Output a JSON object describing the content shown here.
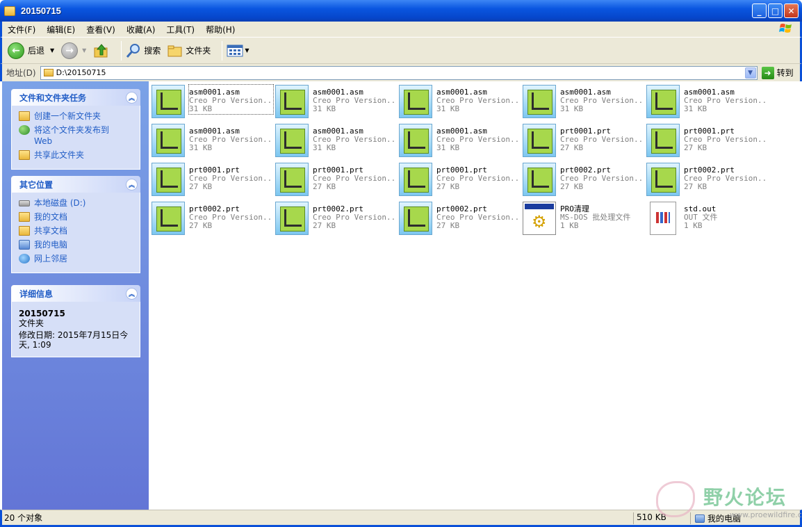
{
  "window": {
    "title": "20150715"
  },
  "menu": [
    "文件(F)",
    "编辑(E)",
    "查看(V)",
    "收藏(A)",
    "工具(T)",
    "帮助(H)"
  ],
  "toolbar": {
    "back": "后退",
    "search": "搜索",
    "folders": "文件夹"
  },
  "address": {
    "label": "地址(D)",
    "value": "D:\\20150715",
    "go": "转到"
  },
  "tasks": {
    "title": "文件和文件夹任务",
    "items": [
      "创建一个新文件夹",
      "将这个文件夹发布到 Web",
      "共享此文件夹"
    ]
  },
  "places": {
    "title": "其它位置",
    "items": [
      "本地磁盘 (D:)",
      "我的文档",
      "共享文档",
      "我的电脑",
      "网上邻居"
    ]
  },
  "details": {
    "title": "详细信息",
    "name": "20150715",
    "type": "文件夹",
    "modified": "修改日期: 2015年7月15日今天, 1:09"
  },
  "files": [
    {
      "name": "asm0001.asm",
      "type": "Creo Pro Version...",
      "size": "31 KB",
      "icon": "creo-icon"
    },
    {
      "name": "asm0001.asm",
      "type": "Creo Pro Version...",
      "size": "31 KB",
      "icon": "creo-icon"
    },
    {
      "name": "asm0001.asm",
      "type": "Creo Pro Version...",
      "size": "31 KB",
      "icon": "creo-icon"
    },
    {
      "name": "asm0001.asm",
      "type": "Creo Pro Version...",
      "size": "31 KB",
      "icon": "creo-icon"
    },
    {
      "name": "asm0001.asm",
      "type": "Creo Pro Version...",
      "size": "31 KB",
      "icon": "creo-icon"
    },
    {
      "name": "asm0001.asm",
      "type": "Creo Pro Version...",
      "size": "31 KB",
      "icon": "creo-icon"
    },
    {
      "name": "asm0001.asm",
      "type": "Creo Pro Version...",
      "size": "31 KB",
      "icon": "creo-icon"
    },
    {
      "name": "asm0001.asm",
      "type": "Creo Pro Version...",
      "size": "31 KB",
      "icon": "creo-icon"
    },
    {
      "name": "prt0001.prt",
      "type": "Creo Pro Version...",
      "size": "27 KB",
      "icon": "creo-icon"
    },
    {
      "name": "prt0001.prt",
      "type": "Creo Pro Version...",
      "size": "27 KB",
      "icon": "creo-icon"
    },
    {
      "name": "prt0001.prt",
      "type": "Creo Pro Version...",
      "size": "27 KB",
      "icon": "creo-icon"
    },
    {
      "name": "prt0001.prt",
      "type": "Creo Pro Version...",
      "size": "27 KB",
      "icon": "creo-icon"
    },
    {
      "name": "prt0001.prt",
      "type": "Creo Pro Version...",
      "size": "27 KB",
      "icon": "creo-icon"
    },
    {
      "name": "prt0002.prt",
      "type": "Creo Pro Version...",
      "size": "27 KB",
      "icon": "creo-icon"
    },
    {
      "name": "prt0002.prt",
      "type": "Creo Pro Version...",
      "size": "27 KB",
      "icon": "creo-icon"
    },
    {
      "name": "prt0002.prt",
      "type": "Creo Pro Version...",
      "size": "27 KB",
      "icon": "creo-icon"
    },
    {
      "name": "prt0002.prt",
      "type": "Creo Pro Version...",
      "size": "27 KB",
      "icon": "creo-icon"
    },
    {
      "name": "prt0002.prt",
      "type": "Creo Pro Version...",
      "size": "27 KB",
      "icon": "creo-icon"
    },
    {
      "name": "PRO清理",
      "type": "MS-DOS 批处理文件",
      "size": "1 KB",
      "icon": "batch-file-icon"
    },
    {
      "name": "std.out",
      "type": "OUT 文件",
      "size": "1 KB",
      "icon": "out-file-icon"
    }
  ],
  "status": {
    "count": "20 个对象",
    "size": "510 KB",
    "location": "我的电脑"
  },
  "watermark": {
    "text": "野火论坛",
    "url": "www.proewildfire.cn"
  }
}
